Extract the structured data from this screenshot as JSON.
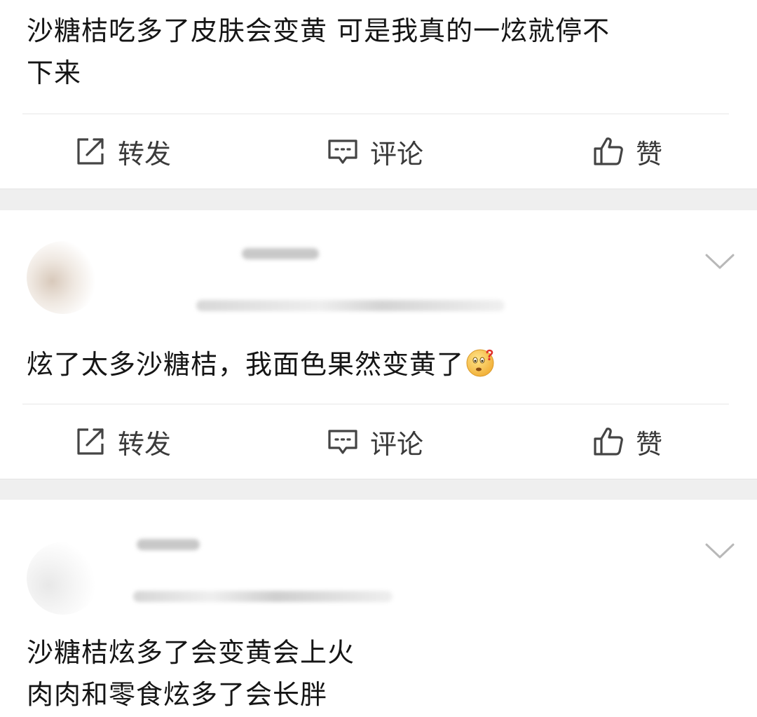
{
  "posts": [
    {
      "text_lines": [
        "沙糖桔吃多了皮肤会变黄  可是我真的一炫就停不",
        "下来"
      ],
      "actions": {
        "repost": "转发",
        "comment": "评论",
        "like": "赞"
      }
    },
    {
      "text_lines": [
        "炫了太多沙糖桔，我面色果然变黄了"
      ],
      "emoji": "thinking-face-icon",
      "actions": {
        "repost": "转发",
        "comment": "评论",
        "like": "赞"
      }
    },
    {
      "text_lines": [
        "沙糖桔炫多了会变黄会上火",
        "肉肉和零食炫多了会长胖"
      ]
    }
  ],
  "colors": {
    "text": "#151515",
    "action_text": "#3a3a3a",
    "icon": "#444444",
    "separator": "#efefef"
  }
}
